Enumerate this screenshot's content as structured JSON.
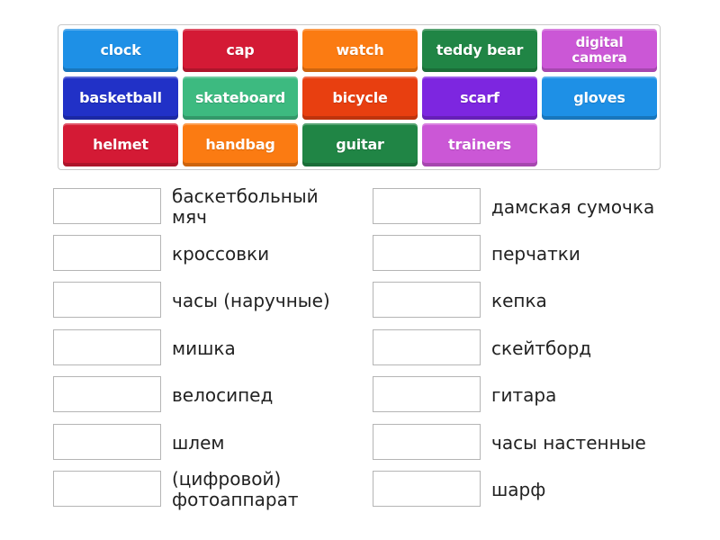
{
  "tiles": [
    {
      "label": "clock",
      "color": "#1e90e6"
    },
    {
      "label": "cap",
      "color": "#d41a35"
    },
    {
      "label": "watch",
      "color": "#fb7b12"
    },
    {
      "label": "teddy bear",
      "color": "#208545"
    },
    {
      "label": "digital camera",
      "color": "#cb57d6"
    },
    {
      "label": "basketball",
      "color": "#2131c7"
    },
    {
      "label": "skateboard",
      "color": "#3dba80"
    },
    {
      "label": "bicycle",
      "color": "#e83f10"
    },
    {
      "label": "scarf",
      "color": "#7d26e0"
    },
    {
      "label": "gloves",
      "color": "#1e90e6"
    },
    {
      "label": "helmet",
      "color": "#d41a35"
    },
    {
      "label": "handbag",
      "color": "#fb7b12"
    },
    {
      "label": "guitar",
      "color": "#208545"
    },
    {
      "label": "trainers",
      "color": "#cb57d6"
    }
  ],
  "left_items": [
    {
      "label": "баскетбольный мяч",
      "answer": ""
    },
    {
      "label": "кроссовки",
      "answer": ""
    },
    {
      "label": "часы (наручные)",
      "answer": ""
    },
    {
      "label": "мишка",
      "answer": ""
    },
    {
      "label": "велосипед",
      "answer": ""
    },
    {
      "label": "шлем",
      "answer": ""
    },
    {
      "label": "(цифровой) фотоаппарат",
      "answer": ""
    }
  ],
  "right_items": [
    {
      "label": "дамская сумочка",
      "answer": ""
    },
    {
      "label": "перчатки",
      "answer": ""
    },
    {
      "label": "кепка",
      "answer": ""
    },
    {
      "label": "скейтборд",
      "answer": ""
    },
    {
      "label": "гитара",
      "answer": ""
    },
    {
      "label": "часы настенные",
      "answer": ""
    },
    {
      "label": "шарф",
      "answer": ""
    }
  ]
}
